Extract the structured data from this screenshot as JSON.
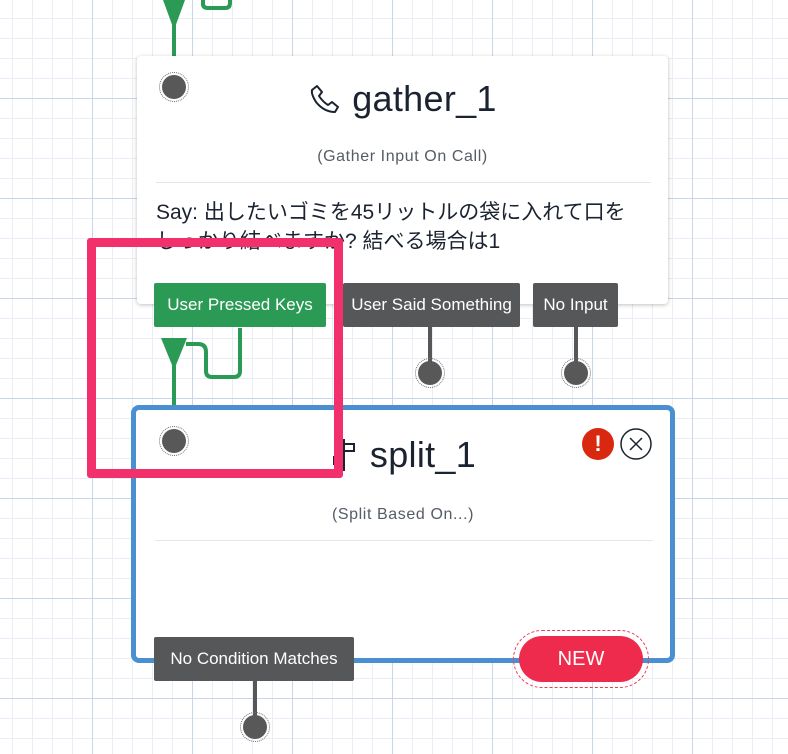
{
  "gather_widget": {
    "title": "gather_1",
    "icon": "phone-icon",
    "subtitle": "(Gather Input On Call)",
    "body": "Say: 出したいゴミを45リットルの袋に入れて口をしっかり結べますか? 結べる場合は1",
    "transitions": [
      "User Pressed Keys",
      "User Said Something",
      "No Input"
    ]
  },
  "split_widget": {
    "title": "split_1",
    "icon": "split-icon",
    "subtitle": "(Split Based On...)",
    "body": "",
    "status_icons": [
      "warning-icon",
      "close-icon"
    ],
    "transitions": [
      "No Condition Matches"
    ],
    "new_label": "NEW"
  },
  "colors": {
    "connected_green": "#2a9a55",
    "transition_gray": "#555759",
    "selected_blue": "#4a90d0",
    "new_red": "#ef2b4d",
    "warning_red": "#d8280f",
    "annotation_pink": "#f2306c"
  }
}
